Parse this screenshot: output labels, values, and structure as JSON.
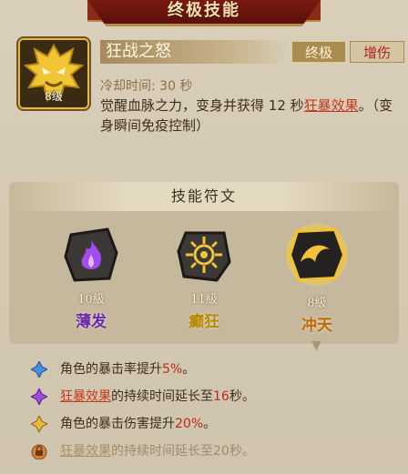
{
  "header": {
    "title": "终极技能"
  },
  "skill": {
    "name": "狂战之怒",
    "level": "8级",
    "tags": [
      "终极",
      "增伤"
    ],
    "cooldown": "冷却时间: 30 秒",
    "description_parts": [
      "觉醒血脉之力，变身并获得 12 秒",
      "狂暴效果",
      "。（变身瞬间免疫控制）"
    ]
  },
  "runes": {
    "title": "技能符文",
    "items": [
      {
        "level": "10級",
        "name": "薄发",
        "color": "#6e2aa8"
      },
      {
        "level": "11級",
        "name": "癫狂",
        "color": "#b88a00"
      },
      {
        "level": "8級",
        "name": "冲天",
        "color": "#c26a00"
      }
    ]
  },
  "effects": [
    {
      "icon": "blue-diamond-icon",
      "parts": [
        "角色的暴击率提升",
        "5%",
        "。"
      ]
    },
    {
      "icon": "purple-diamond-icon",
      "parts": [
        "狂暴效果",
        "的持续时间延长至",
        "16",
        "秒。"
      ]
    },
    {
      "icon": "gold-diamond-icon",
      "parts": [
        "角色的暴击伤害提升",
        "20%",
        "。"
      ]
    },
    {
      "icon": "lock-icon",
      "parts": [
        "狂暴效果",
        "的持续时间延长至20秒。"
      ]
    }
  ],
  "colors": {
    "accent_red": "#c0291b",
    "gold": "#e3b84a"
  }
}
